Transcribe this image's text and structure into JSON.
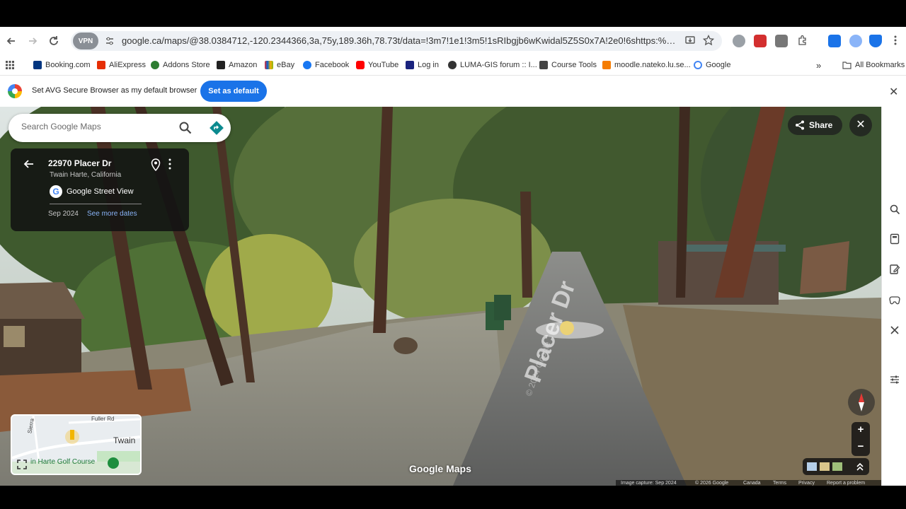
{
  "browser": {
    "vpn_label": "VPN",
    "url": "google.ca/maps/@38.0384712,-120.2344366,3a,75y,189.36h,78.73t/data=!3m7!1e1!3m5!1sRIbgjb6wKwidal5Z5S0x7A!2e0!6shttps:%2F%2Fstreetviewp..."
  },
  "bookmarks": [
    {
      "label": "Booking.com",
      "color": "#003580"
    },
    {
      "label": "AliExpress",
      "color": "#e62e04"
    },
    {
      "label": "Addons Store",
      "color": "#2e7d32"
    },
    {
      "label": "Amazon",
      "color": "#222222"
    },
    {
      "label": "eBay",
      "color": "#e53238"
    },
    {
      "label": "Facebook",
      "color": "#1877f2"
    },
    {
      "label": "YouTube",
      "color": "#ff0000"
    },
    {
      "label": "Log in",
      "color": "#1a237e"
    },
    {
      "label": "LUMA-GIS forum :: I...",
      "color": "#333333"
    },
    {
      "label": "Course Tools",
      "color": "#444444"
    },
    {
      "label": "moodle.nateko.lu.se...",
      "color": "#f57c00"
    },
    {
      "label": "Google",
      "color": "#4285f4"
    }
  ],
  "bookmarks_all": "All Bookmarks",
  "avg": {
    "message": "Set AVG Secure Browser as my default browser",
    "button": "Set as default"
  },
  "maps": {
    "search_placeholder": "Search Google Maps",
    "place_title": "22970 Placer Dr",
    "place_subtitle": "Twain Harte, California",
    "source": "Google Street View",
    "date": "Sep 2024",
    "see_more": "See more dates",
    "share": "Share",
    "street_label": "Placer Dr",
    "street_copyright": "© 2024 Google",
    "watermark": "Google Maps",
    "minimap": {
      "road": "Fuller Rd",
      "place": "Twain",
      "golf": "in Harte Golf Course",
      "side_road": "Sierra"
    },
    "footer": [
      "Image capture: Sep 2024",
      "© 2026 Google",
      "Canada",
      "Terms",
      "Privacy",
      "Report a problem"
    ]
  }
}
